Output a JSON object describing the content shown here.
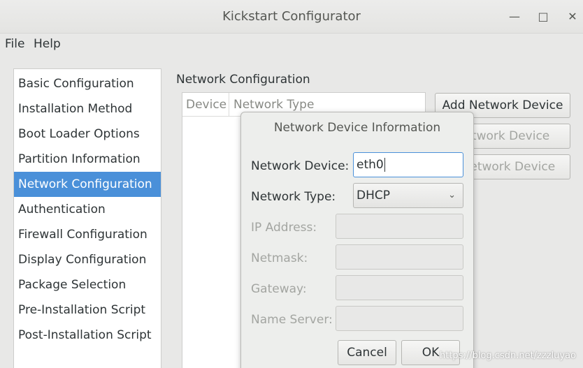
{
  "window": {
    "title": "Kickstart Configurator",
    "minimize_glyph": "—",
    "maximize_glyph": "□",
    "close_glyph": "✕"
  },
  "menubar": {
    "items": [
      "File",
      "Help"
    ]
  },
  "sidebar": {
    "items": [
      "Basic Configuration",
      "Installation Method",
      "Boot Loader Options",
      "Partition Information",
      "Network Configuration",
      "Authentication",
      "Firewall Configuration",
      "Display Configuration",
      "Package Selection",
      "Pre-Installation Script",
      "Post-Installation Script"
    ],
    "selected_index": 4
  },
  "main": {
    "section_title": "Network Configuration",
    "table": {
      "columns": [
        "Device",
        "Network Type"
      ]
    },
    "buttons": {
      "add": "Add Network Device",
      "edit": "Network Device",
      "delete": "e Network Device"
    }
  },
  "dialog": {
    "title": "Network Device Information",
    "network_device_label": "Network Device:",
    "network_device_value": "eth0",
    "network_type_label": "Network Type:",
    "network_type_value": "DHCP",
    "ip_label": "IP Address:",
    "netmask_label": "Netmask:",
    "gateway_label": "Gateway:",
    "nameserver_label": "Name Server:",
    "cancel": "Cancel",
    "ok": "OK"
  },
  "watermark": "https://blog.csdn.net/zzzluyao",
  "colors": {
    "selection": "#4a90d9",
    "window_bg": "#e8e8e7"
  }
}
